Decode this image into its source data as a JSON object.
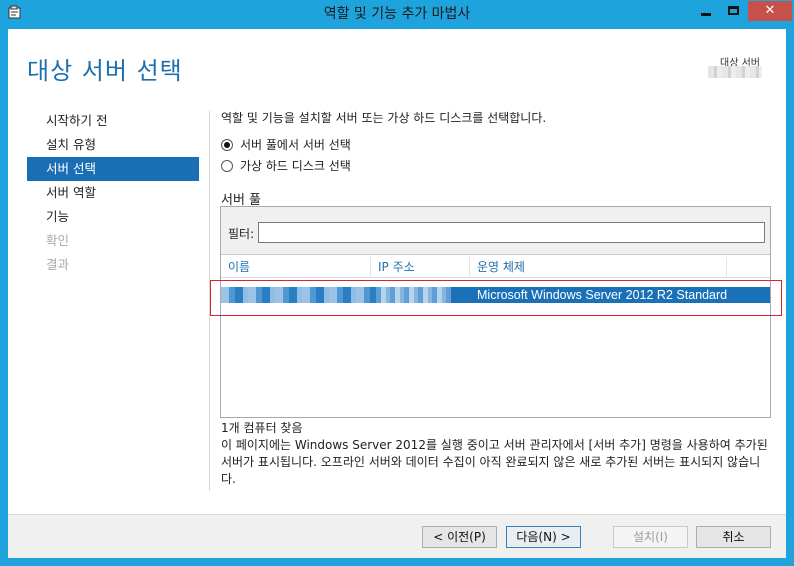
{
  "window": {
    "title": "역할 및 기능 추가 마법사",
    "close_glyph": "✕"
  },
  "header": {
    "page_title": "대상 서버 선택",
    "dest_label": "대상 서버"
  },
  "sidebar": {
    "items": [
      {
        "label": "시작하기 전",
        "state": "normal"
      },
      {
        "label": "설치 유형",
        "state": "normal"
      },
      {
        "label": "서버 선택",
        "state": "active"
      },
      {
        "label": "서버 역할",
        "state": "normal"
      },
      {
        "label": "기능",
        "state": "normal"
      },
      {
        "label": "확인",
        "state": "disabled"
      },
      {
        "label": "결과",
        "state": "disabled"
      }
    ]
  },
  "main": {
    "instruction": "역할 및 기능을 설치할 서버 또는 가상 하드 디스크를 선택합니다.",
    "radios": [
      {
        "label": "서버 풀에서 서버 선택",
        "checked": true
      },
      {
        "label": "가상 하드 디스크 선택",
        "checked": false
      }
    ],
    "pool_label": "서버 풀",
    "filter_label": "필터:",
    "filter_value": "",
    "columns": [
      "이름",
      "IP 주소",
      "운영 체제"
    ],
    "rows": [
      {
        "os": "Microsoft Windows Server 2012 R2 Standard",
        "selected": true
      }
    ],
    "found_text": "1개 컴퓨터 찾음",
    "note": "이 페이지에는 Windows Server 2012를 실행 중이고 서버 관리자에서 [서버 추가] 명령을 사용하여 추가된 서버가 표시됩니다. 오프라인 서버와 데이터 수집이 아직 완료되지 않은 새로 추가된 서버는 표시되지 않습니다."
  },
  "buttons": {
    "prev": "< 이전(P)",
    "next": "다음(N) >",
    "install": "설치(I)",
    "cancel": "취소"
  },
  "colors": {
    "titlebar": "#1ea3dd",
    "accent": "#1a6fb4",
    "page_title": "#1f6fad",
    "highlight_box": "#d9252a"
  }
}
